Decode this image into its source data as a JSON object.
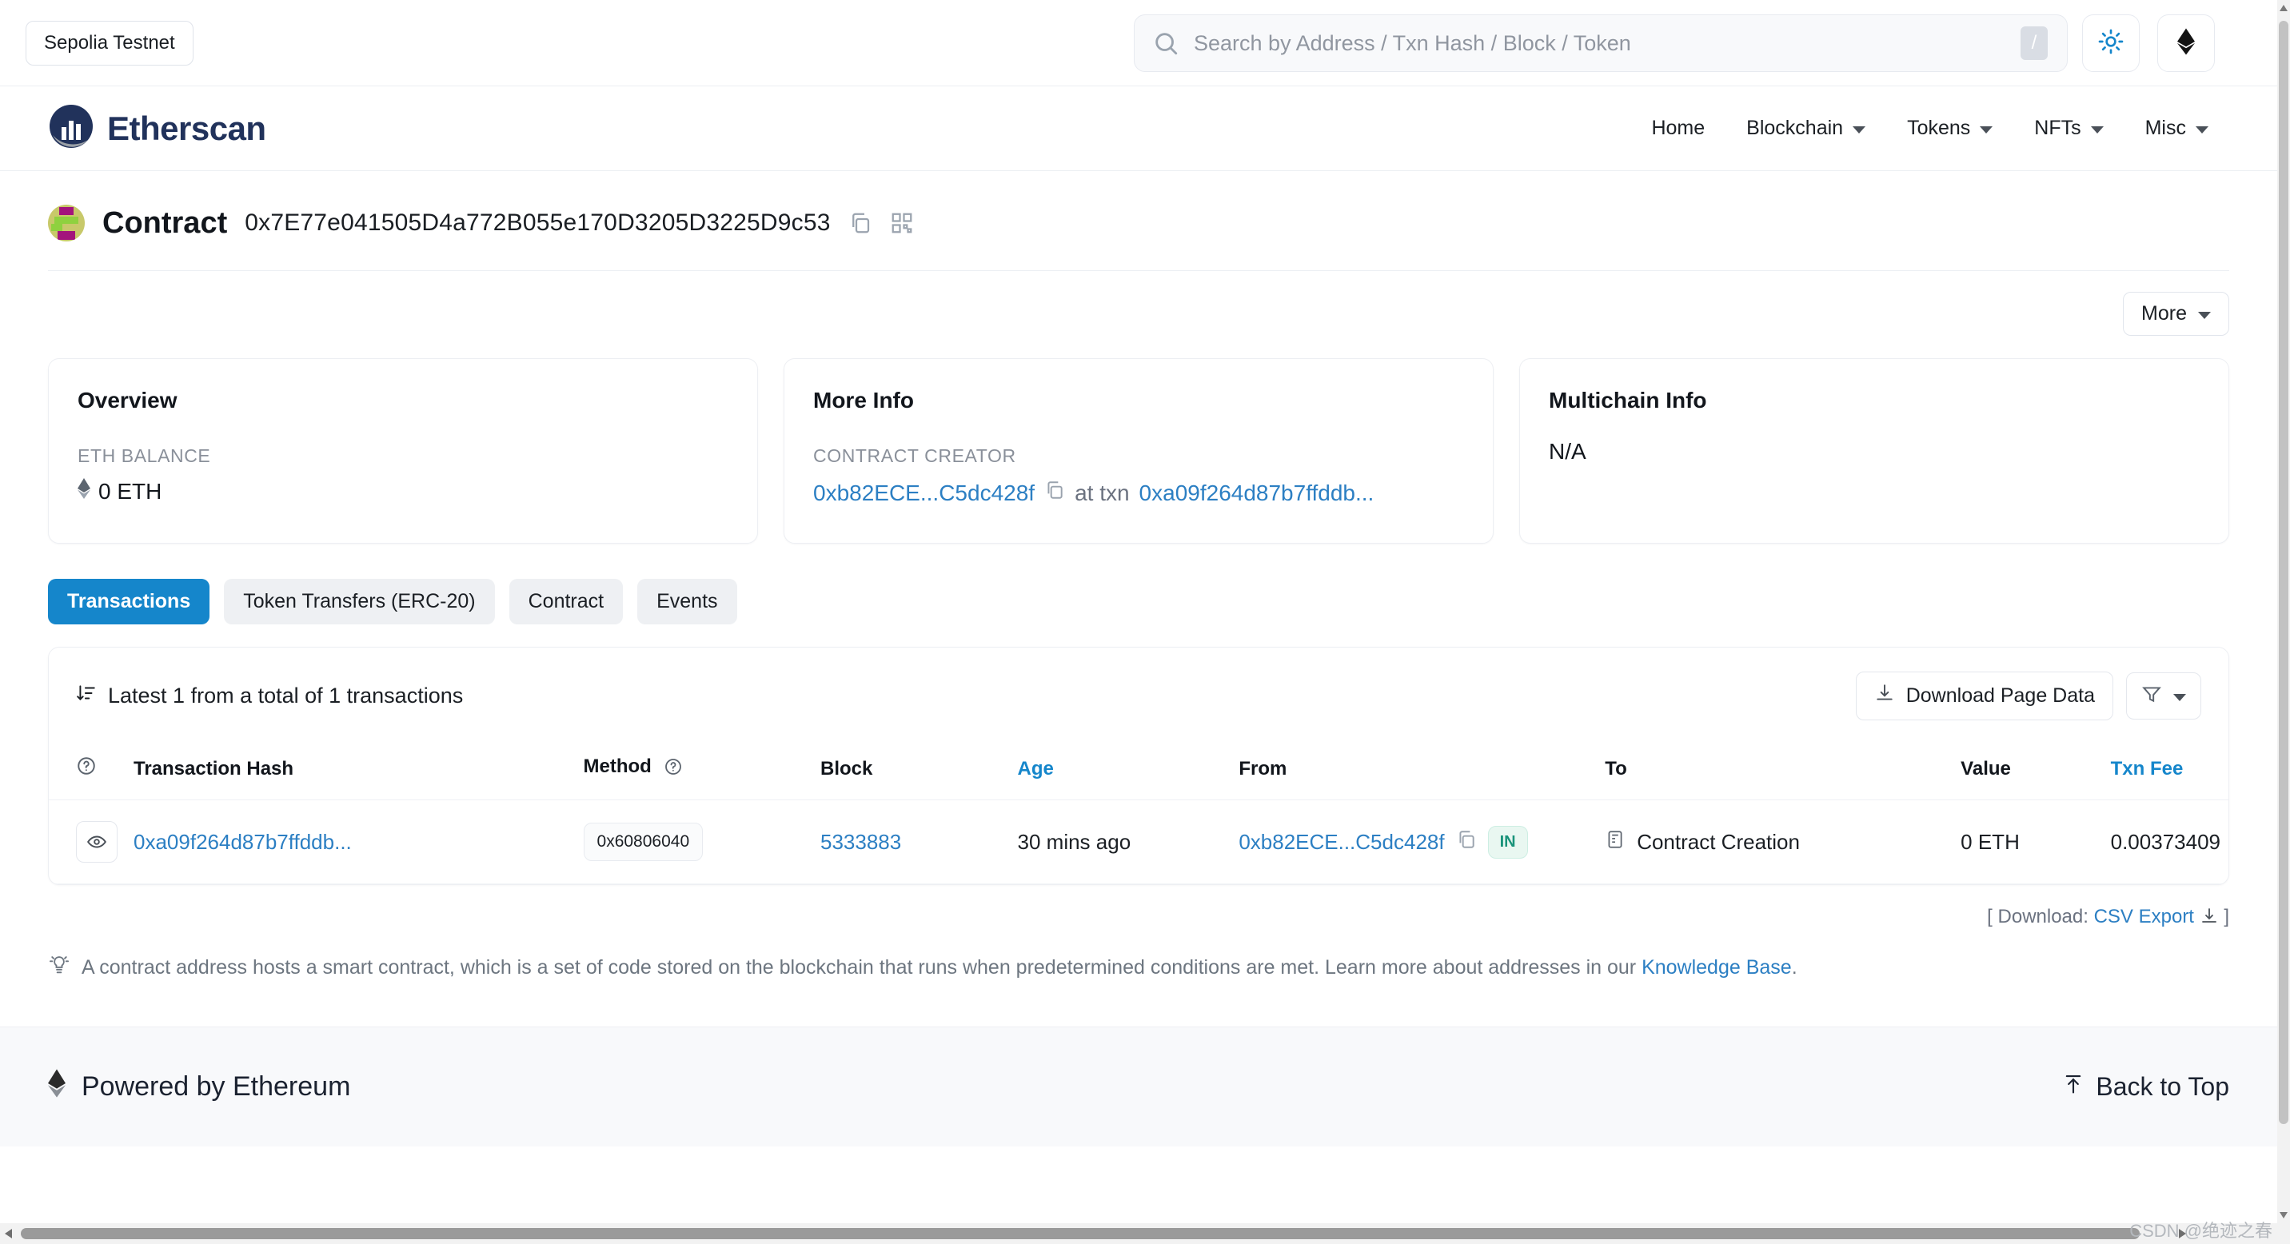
{
  "topbar": {
    "network_label": "Sepolia Testnet",
    "search_placeholder": "Search by Address / Txn Hash / Block / Token",
    "search_value": "",
    "slash_key": "/"
  },
  "header": {
    "brand": "Etherscan",
    "nav": [
      {
        "label": "Home",
        "has_caret": false
      },
      {
        "label": "Blockchain",
        "has_caret": true
      },
      {
        "label": "Tokens",
        "has_caret": true
      },
      {
        "label": "NFTs",
        "has_caret": true
      },
      {
        "label": "Misc",
        "has_caret": true
      }
    ]
  },
  "page_title": {
    "type": "Contract",
    "address": "0x7E77e041505D4a772B055e170D3205D3225D9c53"
  },
  "toolbar": {
    "more_label": "More"
  },
  "cards": {
    "overview": {
      "title": "Overview",
      "balance_label": "ETH BALANCE",
      "balance_value": "0 ETH"
    },
    "more_info": {
      "title": "More Info",
      "creator_label": "CONTRACT CREATOR",
      "creator_address": "0xb82ECE...C5dc428f",
      "at_txn_label": "at txn",
      "creation_txn": "0xa09f264d87b7ffddb..."
    },
    "multichain": {
      "title": "Multichain Info",
      "value": "N/A"
    }
  },
  "tabs": [
    {
      "label": "Transactions",
      "active": true
    },
    {
      "label": "Token Transfers (ERC-20)",
      "active": false
    },
    {
      "label": "Contract",
      "active": false
    },
    {
      "label": "Events",
      "active": false
    }
  ],
  "table_panel": {
    "summary": "Latest 1 from a total of 1 transactions",
    "download_button": "Download Page Data",
    "columns": [
      "",
      "Transaction Hash",
      "Method",
      "Block",
      "Age",
      "From",
      "To",
      "Value",
      "Txn Fee"
    ],
    "sortable_columns": [
      "Age",
      "Txn Fee"
    ],
    "rows": [
      {
        "hash": "0xa09f264d87b7ffddb...",
        "method": "0x60806040",
        "block": "5333883",
        "age": "30 mins ago",
        "from": "0xb82ECE...C5dc428f",
        "direction": "IN",
        "to": "Contract Creation",
        "value": "0 ETH",
        "fee": "0.00373409"
      }
    ],
    "download_footer_prefix": "[ Download:",
    "download_footer_link": "CSV Export",
    "download_footer_suffix": "]"
  },
  "note": {
    "text": "A contract address hosts a smart contract, which is a set of code stored on the blockchain that runs when predetermined conditions are met. Learn more about addresses in our ",
    "link": "Knowledge Base",
    "tail": "."
  },
  "footer": {
    "powered": "Powered by Ethereum",
    "back_to_top": "Back to Top"
  },
  "watermark": "CSDN @绝迹之春",
  "colors": {
    "accent_blue": "#1586cb",
    "link_blue": "#2c7fc3",
    "brand_navy": "#21325b",
    "badge_green": "#19937a"
  }
}
